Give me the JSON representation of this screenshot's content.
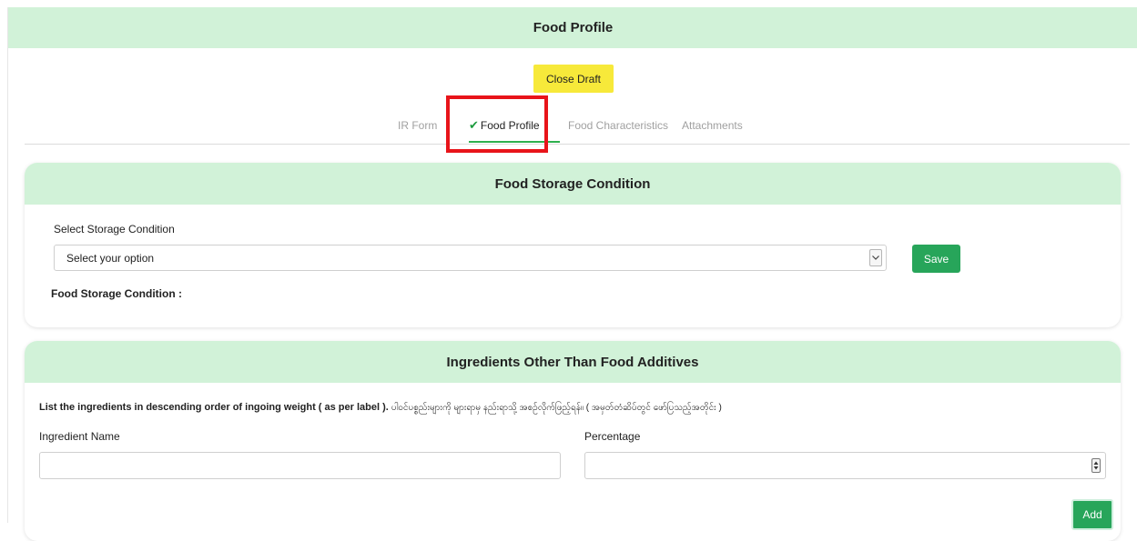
{
  "page": {
    "title": "Food Profile",
    "close_draft_label": "Close Draft"
  },
  "tabs": [
    {
      "label": "IR Form",
      "active": false,
      "checked": false
    },
    {
      "label": "Food Profile",
      "active": true,
      "checked": true,
      "check_icon": "✔"
    },
    {
      "label": "Food Characteristics",
      "active": false,
      "checked": false
    },
    {
      "label": "Attachments",
      "active": false,
      "checked": false
    }
  ],
  "storage": {
    "title": "Food Storage Condition",
    "select_label": "Select Storage Condition",
    "select_value": "Select your option",
    "save_label": "Save",
    "result_label": "Food Storage Condition :",
    "result_value": ""
  },
  "ingredients": {
    "title": "Ingredients Other Than Food Additives",
    "instruction_en": "List the ingredients in descending order of ingoing weight ( as per label ).",
    "instruction_my": "ပါဝင်ပစ္စည်းများကို များရာမှ နည်းရာသို့ အစဉ်လိုက်ဖြည့်ရန်။ ( အမှတ်တံဆိပ်တွင် ဖော်ပြသည့်အတိုင်း )",
    "name_label": "Ingredient Name",
    "name_value": "",
    "percentage_label": "Percentage",
    "percentage_value": "",
    "add_label": "Add"
  },
  "colors": {
    "header_bg": "#d1f2d8",
    "close_draft_bg": "#f7e93a",
    "primary_green": "#27a55a",
    "active_tab_underline": "#2eb04e",
    "highlight_border": "#e8141a"
  },
  "icons": {
    "select_arrow": "chevron-down-icon",
    "number_spinner": "spinner-arrows-icon",
    "tab_check": "check-icon"
  }
}
